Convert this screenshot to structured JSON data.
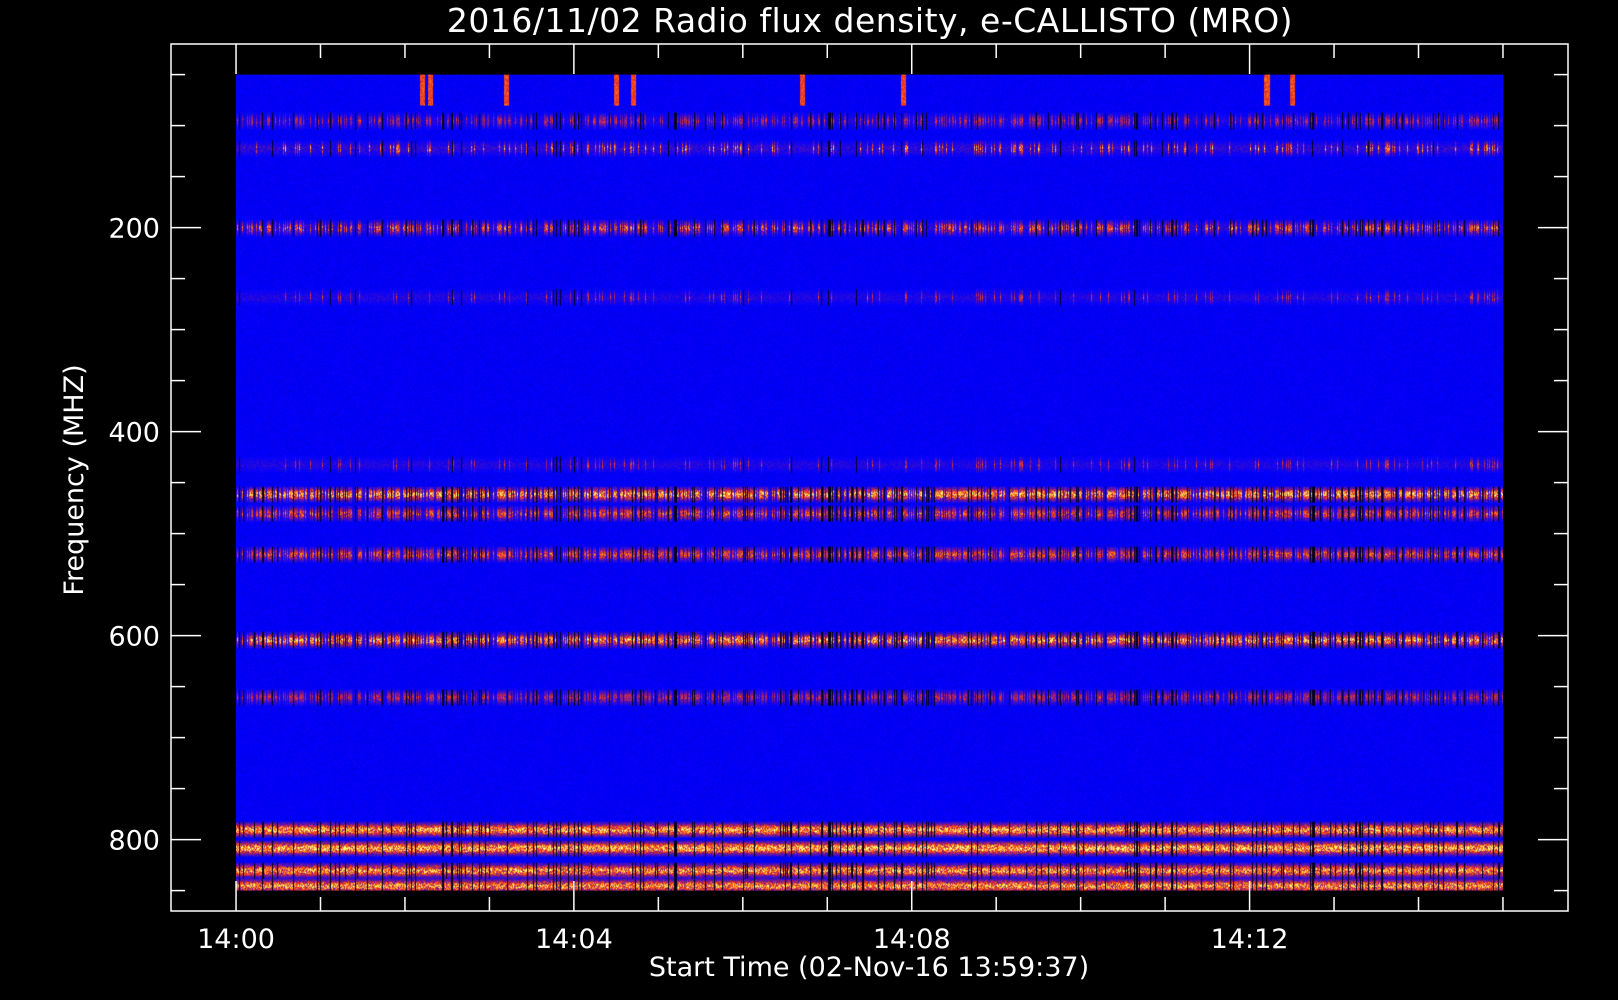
{
  "chart_data": {
    "type": "heatmap",
    "title": "2016/11/02  Radio flux density, e-CALLISTO (MRO)",
    "xlabel": "Start Time (02-Nov-16 13:59:37)",
    "ylabel": "Frequency (MHZ)",
    "x_tick_labels": [
      "14:00",
      "14:04",
      "14:08",
      "14:12"
    ],
    "x_ticks_minutes": [
      0,
      4,
      8,
      12
    ],
    "x_range_minutes": [
      -0.77,
      15.77
    ],
    "x_data_range_minutes": [
      0,
      15.0
    ],
    "y_tick_labels": [
      "200",
      "400",
      "600",
      "800"
    ],
    "y_ticks": [
      200,
      400,
      600,
      800
    ],
    "y_range": [
      20,
      870
    ],
    "y_data_range": [
      50,
      850
    ],
    "y_inverted": true,
    "colormap": [
      "#000000",
      "#0000ff",
      "#7f1b8a",
      "#ff3a10",
      "#ff9a20",
      "#ffff80"
    ],
    "background_color": "#1e1ef5",
    "bands": [
      {
        "freq": 95,
        "intensity": 0.55,
        "spikes": 0.35
      },
      {
        "freq": 122,
        "intensity": 0.85,
        "spikes": 0.15
      },
      {
        "freq": 200,
        "intensity": 0.75,
        "spikes": 0.4
      },
      {
        "freq": 268,
        "intensity": 0.6,
        "spikes": 0.1
      },
      {
        "freq": 432,
        "intensity": 0.6,
        "spikes": 0.1
      },
      {
        "freq": 461,
        "intensity": 0.95,
        "spikes": 0.6
      },
      {
        "freq": 480,
        "intensity": 0.7,
        "spikes": 0.5
      },
      {
        "freq": 520,
        "intensity": 0.7,
        "spikes": 0.55
      },
      {
        "freq": 604,
        "intensity": 0.9,
        "spikes": 0.6
      },
      {
        "freq": 660,
        "intensity": 0.55,
        "spikes": 0.5
      },
      {
        "freq": 790,
        "intensity": 0.95,
        "spikes": 0.85
      },
      {
        "freq": 808,
        "intensity": 1.0,
        "spikes": 0.9
      },
      {
        "freq": 830,
        "intensity": 0.9,
        "spikes": 0.85
      },
      {
        "freq": 845,
        "intensity": 0.9,
        "spikes": 0.9
      }
    ],
    "bursts": [
      {
        "time_minutes": 2.2,
        "freq_range": [
          50,
          80
        ]
      },
      {
        "time_minutes": 2.3,
        "freq_range": [
          50,
          80
        ]
      },
      {
        "time_minutes": 3.2,
        "freq_range": [
          50,
          80
        ]
      },
      {
        "time_minutes": 4.5,
        "freq_range": [
          50,
          80
        ]
      },
      {
        "time_minutes": 4.7,
        "freq_range": [
          50,
          80
        ]
      },
      {
        "time_minutes": 6.7,
        "freq_range": [
          50,
          80
        ]
      },
      {
        "time_minutes": 7.9,
        "freq_range": [
          50,
          80
        ]
      },
      {
        "time_minutes": 12.2,
        "freq_range": [
          50,
          80
        ]
      },
      {
        "time_minutes": 12.5,
        "freq_range": [
          50,
          80
        ]
      }
    ]
  }
}
